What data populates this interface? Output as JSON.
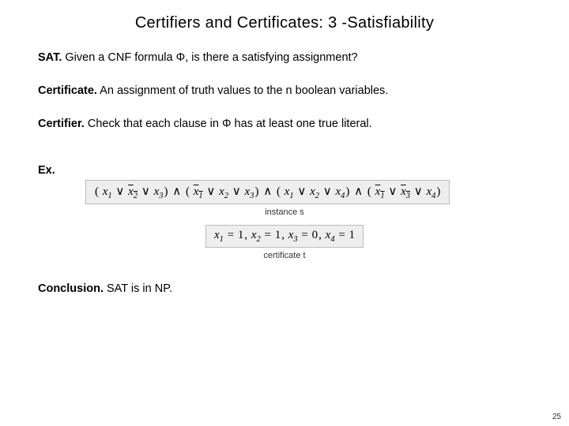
{
  "title": "Certifiers and Certificates:  3 -Satisfiability",
  "sat": {
    "label": "SAT.",
    "text_a": "  Given a CNF formula ",
    "phi": "Φ",
    "text_b": ", is there a satisfying assignment?"
  },
  "certificate": {
    "label": "Certificate.",
    "text": "  An assignment of truth values to the n boolean variables."
  },
  "certifier": {
    "label": "Certifier.",
    "text_a": "  Check that each clause in ",
    "phi": "Φ",
    "text_b": " has at least one true literal."
  },
  "ex_label": "Ex.",
  "formula": {
    "clauses": [
      {
        "lits": [
          {
            "v": "x",
            "i": "1",
            "neg": false
          },
          {
            "v": "x",
            "i": "2",
            "neg": true
          },
          {
            "v": "x",
            "i": "3",
            "neg": false
          }
        ]
      },
      {
        "lits": [
          {
            "v": "x",
            "i": "1",
            "neg": true
          },
          {
            "v": "x",
            "i": "2",
            "neg": false
          },
          {
            "v": "x",
            "i": "3",
            "neg": false
          }
        ]
      },
      {
        "lits": [
          {
            "v": "x",
            "i": "1",
            "neg": false
          },
          {
            "v": "x",
            "i": "2",
            "neg": false
          },
          {
            "v": "x",
            "i": "4",
            "neg": false
          }
        ]
      },
      {
        "lits": [
          {
            "v": "x",
            "i": "1",
            "neg": true
          },
          {
            "v": "x",
            "i": "3",
            "neg": true
          },
          {
            "v": "x",
            "i": "4",
            "neg": false
          }
        ]
      }
    ]
  },
  "caption_instance": "instance s",
  "assignment": [
    {
      "v": "x",
      "i": "1",
      "val": "1"
    },
    {
      "v": "x",
      "i": "2",
      "val": "1"
    },
    {
      "v": "x",
      "i": "3",
      "val": "0"
    },
    {
      "v": "x",
      "i": "4",
      "val": "1"
    }
  ],
  "caption_cert": "certificate t",
  "conclusion": {
    "label": "Conclusion.",
    "text": "  SAT is in NP."
  },
  "page": "25"
}
